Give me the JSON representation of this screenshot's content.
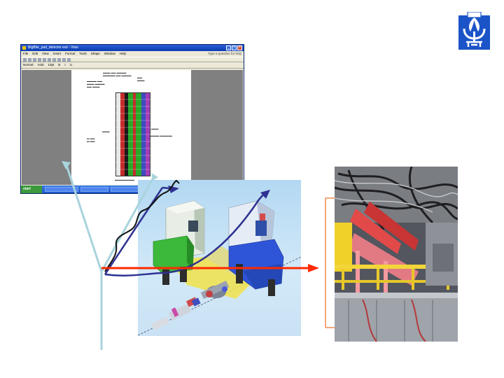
{
  "logo": {
    "name": "university-emblem-icon",
    "color": "#1b54c8"
  },
  "screenshot_window": {
    "title_bar": "BigBite_pad_detector.vsd - Visio",
    "menu": [
      "File",
      "Edit",
      "View",
      "Insert",
      "Format",
      "Tools",
      "Shape",
      "Window",
      "Help"
    ],
    "help_prompt": "Type a question for help",
    "secondary_menu": [
      "Normal",
      "Arial",
      "10pt",
      "B",
      "I",
      "U"
    ],
    "start_label": "start",
    "colors": {
      "title_bar": "#0a3bb0",
      "taskbar": "#2a66d9",
      "workspace": "#808080"
    }
  },
  "render_3d": {
    "name": "spectrometer-3d-model",
    "background": "#c6e2f5"
  },
  "photo": {
    "name": "detector-photograph"
  },
  "annotations": {
    "light_blue_arrow_color": "#a8d4dc",
    "dark_blue_color": "#2e3192",
    "red_beam_color": "#ff2a00",
    "orange_frame_color": "#f08a4a"
  }
}
